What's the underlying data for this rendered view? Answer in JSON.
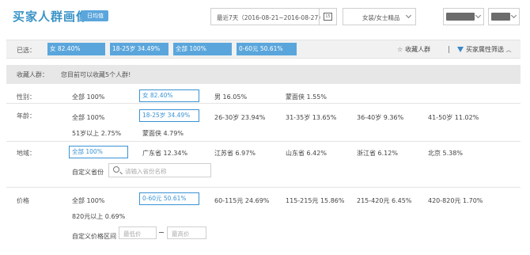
{
  "header": {
    "title": "买家人群画像",
    "badge": "日均值",
    "date_range": "最近7天（2016-08-21~2016-08-27）",
    "calendar_day": "15",
    "category": "女装/女士精品"
  },
  "selected": {
    "label": "已选：",
    "tags": [
      "女  82.40%",
      "18-25岁  34.49%",
      "全部  100%",
      "0-60元  50.61%"
    ],
    "favorite_link": "收藏人群",
    "filter_link": "买家属性筛选"
  },
  "favorite_row": {
    "label": "收藏人群：",
    "message": "您目前可以收藏5个人群!"
  },
  "gender": {
    "label": "性别：",
    "options": [
      "全部   100%",
      "女   82.40%",
      "男   16.05%",
      "蒙面侠   1.55%"
    ]
  },
  "age": {
    "label": "年龄：",
    "options": [
      "全部   100%",
      "18-25岁   34.49%",
      "26-30岁   23.94%",
      "31-35岁   13.65%",
      "36-40岁   9.36%",
      "41-50岁   11.02%",
      "51岁以上   2.75%",
      "蒙面侠   4.79%"
    ]
  },
  "region": {
    "label": "地域：",
    "options": [
      "全部   100%",
      "广东省   12.34%",
      "江苏省   6.97%",
      "山东省   6.42%",
      "浙江省   6.12%",
      "北京   5.38%"
    ],
    "custom_label": "自定义省份",
    "search_placeholder": "请输入省份名称"
  },
  "price": {
    "label": "价格",
    "options": [
      "全部   100%",
      "0-60元   50.61%",
      "60-115元   24.69%",
      "115-215元   15.86%",
      "215-420元   6.45%",
      "420-820元   1.70%",
      "820元以上   0.69%"
    ],
    "custom_label": "自定义价格区间",
    "min_placeholder": "最低价",
    "max_placeholder": "最高价"
  },
  "colors": {
    "accent": "#3a93c7",
    "tag_bg": "#5aa6dc",
    "selected_border": "#3a93d3"
  }
}
